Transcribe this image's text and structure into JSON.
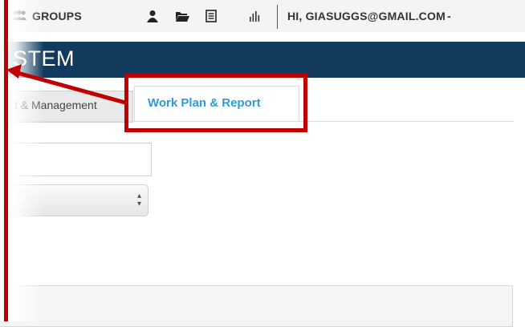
{
  "nav": {
    "groups_label": "GROUPS",
    "groups_icon": "users-icon",
    "user_icon": "user-icon",
    "folder_icon": "folder-open-icon",
    "list_icon": "list-icon",
    "chart_icon": "bar-chart-icon",
    "user_label": "HI, GIASUGGS@GMAIL.COM",
    "user_caret": "-"
  },
  "title": {
    "text": "STEM"
  },
  "tabs": [
    {
      "label": "t & Management",
      "active": false
    },
    {
      "label": "Work Plan & Report",
      "active": true
    }
  ],
  "form": {
    "text_value": "",
    "select_value": ""
  },
  "colors": {
    "accent": "#2f9ad3",
    "titlebar": "#123a5c",
    "highlight": "#c00000"
  }
}
